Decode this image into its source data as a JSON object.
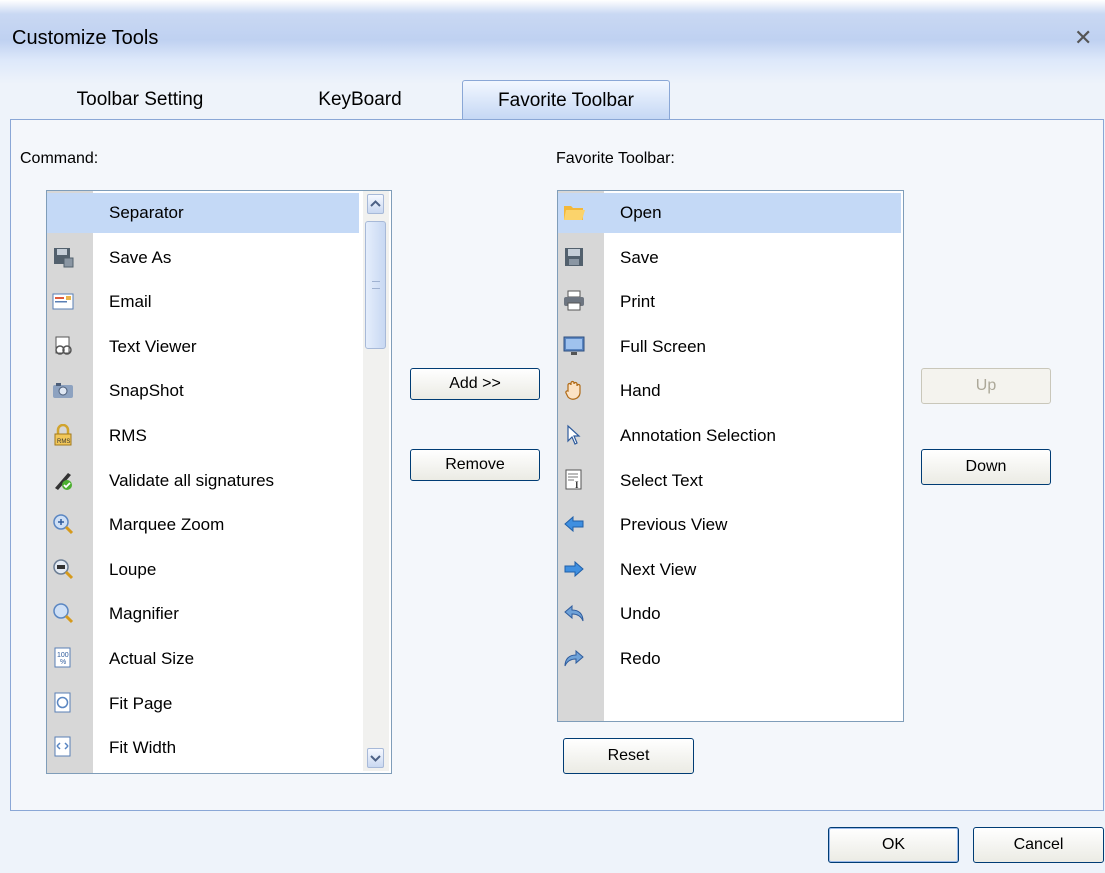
{
  "dialog": {
    "title": "Customize Tools"
  },
  "tabs": [
    {
      "label": "Toolbar Setting",
      "active": false
    },
    {
      "label": "KeyBoard",
      "active": false
    },
    {
      "label": "Favorite Toolbar",
      "active": true
    }
  ],
  "command": {
    "label": "Command:",
    "items": [
      {
        "label": "Separator",
        "icon": "none",
        "selected": true
      },
      {
        "label": "Save As",
        "icon": "save-as-icon"
      },
      {
        "label": "Email",
        "icon": "email-icon"
      },
      {
        "label": "Text Viewer",
        "icon": "text-viewer-icon"
      },
      {
        "label": "SnapShot",
        "icon": "camera-icon"
      },
      {
        "label": "RMS",
        "icon": "rms-lock-icon"
      },
      {
        "label": "Validate all signatures",
        "icon": "validate-signature-icon"
      },
      {
        "label": "Marquee Zoom",
        "icon": "marquee-zoom-icon"
      },
      {
        "label": "Loupe",
        "icon": "loupe-icon"
      },
      {
        "label": "Magnifier",
        "icon": "magnifier-icon"
      },
      {
        "label": "Actual Size",
        "icon": "actual-size-icon"
      },
      {
        "label": "Fit Page",
        "icon": "fit-page-icon"
      },
      {
        "label": "Fit Width",
        "icon": "fit-width-icon"
      }
    ]
  },
  "favorite": {
    "label": "Favorite Toolbar:",
    "items": [
      {
        "label": "Open",
        "icon": "folder-open-icon",
        "selected": true
      },
      {
        "label": "Save",
        "icon": "save-icon"
      },
      {
        "label": "Print",
        "icon": "printer-icon"
      },
      {
        "label": "Full Screen",
        "icon": "full-screen-icon"
      },
      {
        "label": "Hand",
        "icon": "hand-icon"
      },
      {
        "label": "Annotation Selection",
        "icon": "arrow-cursor-icon"
      },
      {
        "label": "Select Text",
        "icon": "select-text-icon"
      },
      {
        "label": "Previous View",
        "icon": "arrow-left-icon"
      },
      {
        "label": "Next View",
        "icon": "arrow-right-icon"
      },
      {
        "label": "Undo",
        "icon": "undo-icon"
      },
      {
        "label": "Redo",
        "icon": "redo-icon"
      }
    ]
  },
  "buttons": {
    "add": "Add >>",
    "remove": "Remove",
    "up": "Up",
    "down": "Down",
    "reset": "Reset",
    "ok": "OK",
    "cancel": "Cancel"
  },
  "colors": {
    "selection": "#c4d9f6",
    "tab_active": "#c3d6f4",
    "icon_column": "#d7d7d7"
  }
}
